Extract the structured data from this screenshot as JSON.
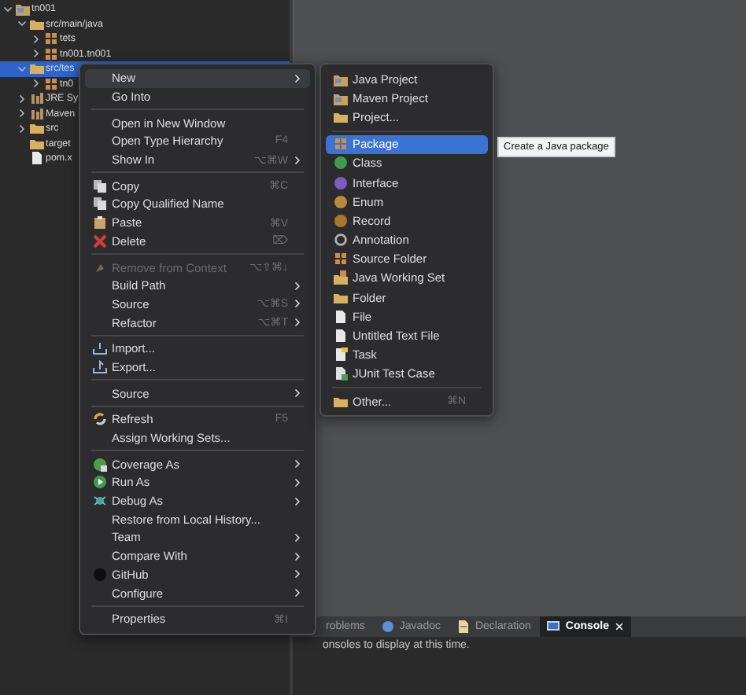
{
  "tree": [
    {
      "label": "tn001",
      "kind": "project",
      "expanded": true,
      "selected": false,
      "children": [
        {
          "label": "src/main/java",
          "kind": "folder",
          "expanded": true,
          "selected": false,
          "children": [
            {
              "label": "tets",
              "kind": "package",
              "expanded": false,
              "selected": false
            },
            {
              "label": "tn001.tn001",
              "kind": "package",
              "expanded": false,
              "selected": false
            }
          ]
        },
        {
          "label": "src/tes",
          "kind": "folder",
          "expanded": true,
          "selected": true,
          "children": [
            {
              "label": "tn0",
              "kind": "package",
              "expanded": false,
              "selected": false
            }
          ]
        },
        {
          "label": "JRE Sy",
          "kind": "library",
          "expanded": false,
          "selected": false
        },
        {
          "label": "Maven",
          "kind": "library",
          "expanded": false,
          "selected": false
        },
        {
          "label": "src",
          "kind": "folder",
          "expanded": false,
          "selected": false
        },
        {
          "label": "target",
          "kind": "folder",
          "selected": false
        },
        {
          "label": "pom.x",
          "kind": "file",
          "selected": false
        }
      ]
    }
  ],
  "context_menu": [
    {
      "label": "New",
      "kind": "text",
      "submenu": true,
      "selected": true,
      "disabled": false
    },
    {
      "label": "Go Into",
      "kind": "text",
      "submenu": false,
      "selected": false,
      "disabled": false
    },
    {
      "kind": "separator"
    },
    {
      "label": "Open in New Window",
      "kind": "text",
      "submenu": false,
      "selected": false,
      "disabled": false
    },
    {
      "label": "Open Type Hierarchy",
      "kind": "text",
      "shortcut": "F4",
      "submenu": false,
      "selected": false,
      "disabled": false
    },
    {
      "label": "Show In",
      "kind": "text",
      "shortcut": "⌥⌘W",
      "submenu": true,
      "selected": false,
      "disabled": false
    },
    {
      "kind": "separator"
    },
    {
      "label": "Copy",
      "kind": "copy",
      "shortcut": "⌘C",
      "submenu": false,
      "selected": false,
      "disabled": false
    },
    {
      "label": "Copy Qualified Name",
      "kind": "copy",
      "submenu": false,
      "selected": false,
      "disabled": false
    },
    {
      "label": "Paste",
      "kind": "paste",
      "shortcut": "⌘V",
      "submenu": false,
      "selected": false,
      "disabled": false
    },
    {
      "label": "Delete",
      "kind": "delete",
      "shortcut": "⌦",
      "submenu": false,
      "selected": false,
      "disabled": false
    },
    {
      "kind": "separator"
    },
    {
      "label": "Remove from Context",
      "kind": "remove",
      "shortcut": "⌥⇧⌘↓",
      "submenu": false,
      "selected": false,
      "disabled": true
    },
    {
      "label": "Build Path",
      "kind": "text",
      "submenu": true,
      "selected": false,
      "disabled": false
    },
    {
      "label": "Source",
      "kind": "text",
      "shortcut": "⌥⌘S",
      "submenu": true,
      "selected": false,
      "disabled": false
    },
    {
      "label": "Refactor",
      "kind": "text",
      "shortcut": "⌥⌘T",
      "submenu": true,
      "selected": false,
      "disabled": false
    },
    {
      "kind": "separator"
    },
    {
      "label": "Import...",
      "kind": "import",
      "submenu": false,
      "selected": false,
      "disabled": false
    },
    {
      "label": "Export...",
      "kind": "export",
      "submenu": false,
      "selected": false,
      "disabled": false
    },
    {
      "kind": "separator"
    },
    {
      "label": "Source",
      "kind": "text",
      "submenu": true,
      "selected": false,
      "disabled": false
    },
    {
      "kind": "separator"
    },
    {
      "label": "Refresh",
      "kind": "refresh",
      "shortcut": "F5",
      "submenu": false,
      "selected": false,
      "disabled": false
    },
    {
      "label": "Assign Working Sets...",
      "kind": "text",
      "submenu": false,
      "selected": false,
      "disabled": false
    },
    {
      "kind": "separator"
    },
    {
      "label": "Coverage As",
      "kind": "coverage",
      "submenu": true,
      "selected": false,
      "disabled": false
    },
    {
      "label": "Run As",
      "kind": "run",
      "submenu": true,
      "selected": false,
      "disabled": false
    },
    {
      "label": "Debug As",
      "kind": "debug",
      "submenu": true,
      "selected": false,
      "disabled": false
    },
    {
      "label": "Restore from Local History...",
      "kind": "text",
      "submenu": false,
      "selected": false,
      "disabled": false
    },
    {
      "label": "Team",
      "kind": "text",
      "submenu": true,
      "selected": false,
      "disabled": false
    },
    {
      "label": "Compare With",
      "kind": "text",
      "submenu": true,
      "selected": false,
      "disabled": false
    },
    {
      "label": "GitHub",
      "kind": "github",
      "submenu": true,
      "selected": false,
      "disabled": false
    },
    {
      "label": "Configure",
      "kind": "text",
      "submenu": true,
      "selected": false,
      "disabled": false
    },
    {
      "kind": "separator"
    },
    {
      "label": "Properties",
      "kind": "text",
      "shortcut": "⌘I",
      "submenu": false,
      "selected": false,
      "disabled": false
    }
  ],
  "new_submenu": [
    {
      "label": "Java Project",
      "kind": "project",
      "selected": false
    },
    {
      "label": "Maven Project",
      "kind": "project",
      "selected": false
    },
    {
      "label": "Project...",
      "kind": "folder",
      "selected": false
    },
    {
      "kind": "separator"
    },
    {
      "label": "Package",
      "kind": "package",
      "selected": true
    },
    {
      "label": "Class",
      "kind": "class",
      "selected": false
    },
    {
      "label": "Interface",
      "kind": "interface",
      "selected": false
    },
    {
      "label": "Enum",
      "kind": "enum",
      "selected": false
    },
    {
      "label": "Record",
      "kind": "record",
      "selected": false
    },
    {
      "label": "Annotation",
      "kind": "annotation",
      "selected": false
    },
    {
      "label": "Source Folder",
      "kind": "package",
      "selected": false
    },
    {
      "label": "Java Working Set",
      "kind": "workingset",
      "selected": false
    },
    {
      "label": "Folder",
      "kind": "folder",
      "selected": false
    },
    {
      "label": "File",
      "kind": "file",
      "selected": false
    },
    {
      "label": "Untitled Text File",
      "kind": "file",
      "selected": false
    },
    {
      "label": "Task",
      "kind": "task",
      "selected": false
    },
    {
      "label": "JUnit Test Case",
      "kind": "junit",
      "selected": false
    },
    {
      "kind": "separator"
    },
    {
      "label": "Other...",
      "kind": "folder",
      "shortcut": "⌘N",
      "selected": false
    }
  ],
  "tooltip": {
    "text": "Create a Java package"
  },
  "bottom_panel": {
    "tabs": [
      {
        "label": "roblems",
        "kind": "text",
        "selected": false,
        "closable": false
      },
      {
        "label": "Javadoc",
        "kind": "javadoc",
        "selected": false,
        "closable": false
      },
      {
        "label": "Declaration",
        "kind": "declaration",
        "selected": false,
        "closable": false
      },
      {
        "label": "Console",
        "kind": "console",
        "selected": true,
        "closable": true
      }
    ],
    "message": "onsoles to display at this time."
  }
}
